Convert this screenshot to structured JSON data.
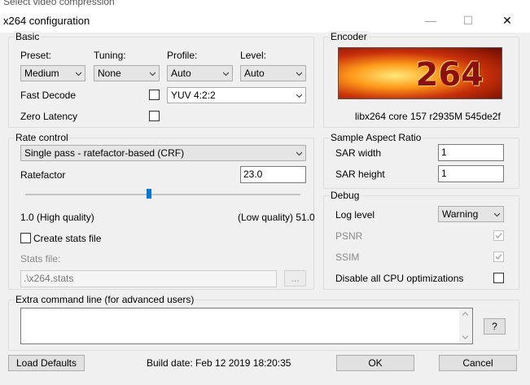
{
  "window": {
    "behind_title": "Select video compression",
    "title": "x264 configuration",
    "minimize_glyph": "—",
    "maximize_glyph": "☐",
    "close_glyph": "✕"
  },
  "basic": {
    "group_title": "Basic",
    "preset_label": "Preset:",
    "preset_value": "Medium",
    "tuning_label": "Tuning:",
    "tuning_value": "None",
    "profile_label": "Profile:",
    "profile_value": "Auto",
    "level_label": "Level:",
    "level_value": "Auto",
    "fast_decode_label": "Fast Decode",
    "fast_decode_checked": false,
    "colorspace_value": "YUV 4:2:2",
    "zero_latency_label": "Zero Latency",
    "zero_latency_checked": false
  },
  "encoder": {
    "group_title": "Encoder",
    "logo_text": "264",
    "version": "libx264 core 157 r2935M 545de2f"
  },
  "rate_control": {
    "group_title": "Rate control",
    "mode_value": "Single pass - ratefactor-based (CRF)",
    "ratefactor_label": "Ratefactor",
    "ratefactor_value": "23.0",
    "slider_fraction": 0.45,
    "min_label": "1.0 (High quality)",
    "max_label": "(Low quality) 51.0",
    "create_stats_label": "Create stats file",
    "create_stats_checked": false,
    "stats_file_label": "Stats file:",
    "stats_file_value": ".\\x264.stats",
    "browse_label": "..."
  },
  "sar": {
    "group_title": "Sample Aspect Ratio",
    "width_label": "SAR width",
    "width_value": "1",
    "height_label": "SAR height",
    "height_value": "1"
  },
  "debug": {
    "group_title": "Debug",
    "log_level_label": "Log level",
    "log_level_value": "Warning",
    "psnr_label": "PSNR",
    "psnr_checked": true,
    "ssim_label": "SSIM",
    "ssim_checked": true,
    "disable_cpu_label": "Disable all CPU optimizations",
    "disable_cpu_checked": false
  },
  "extra": {
    "group_title": "Extra command line (for advanced users)",
    "value": "",
    "help_label": "?"
  },
  "footer": {
    "load_defaults_label": "Load Defaults",
    "build_date": "Build date: Feb 12 2019 18:20:35",
    "ok_label": "OK",
    "cancel_label": "Cancel"
  }
}
